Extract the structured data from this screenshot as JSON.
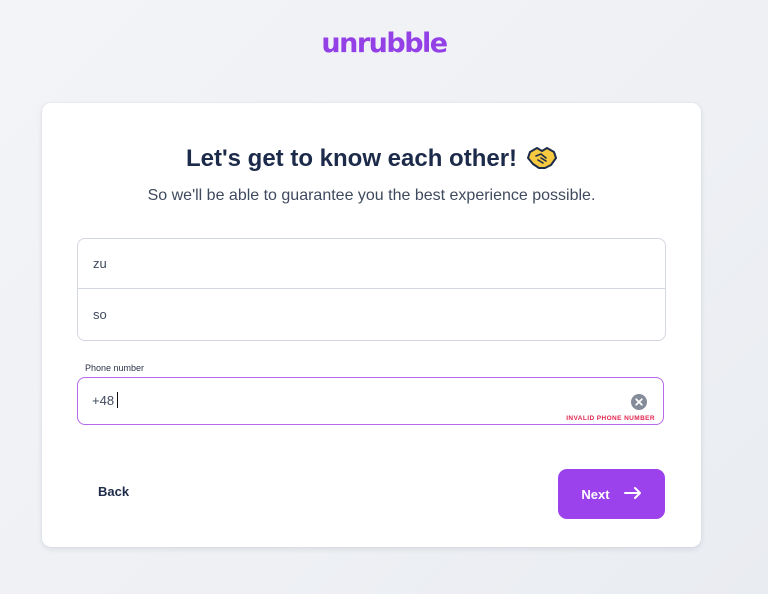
{
  "brand": {
    "logo_text": "unrubble",
    "color": "#9340e6"
  },
  "header": {
    "title": "Let's get to know each other!",
    "title_icon": "handshake-emoji-icon",
    "subtitle": "So we'll be able to guarantee you the best experience possible."
  },
  "form": {
    "first_name": {
      "value": "zu"
    },
    "last_name": {
      "value": "so"
    },
    "phone": {
      "label": "Phone number",
      "value": "+48",
      "clear_icon": "clear-circle-icon",
      "error": "INVALID PHONE NUMBER",
      "error_color": "#e0264e",
      "focus_color": "#b469e8"
    }
  },
  "actions": {
    "back_label": "Back",
    "next_label": "Next",
    "next_icon": "arrow-right-icon",
    "next_color": "#9b42ec"
  }
}
